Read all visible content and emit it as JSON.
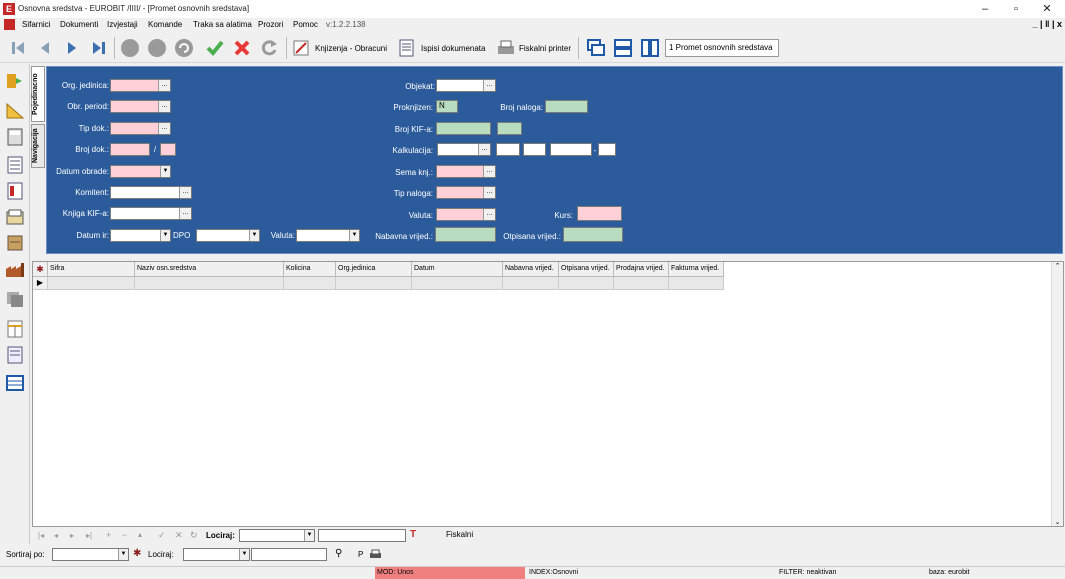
{
  "window": {
    "title": "Osnovna sredstva - EUROBIT /IIII/ - [Promet osnovnih sredstava]",
    "minimize": "–",
    "restore": "▫",
    "close": "✕",
    "mdi_controls": "_ | ǁ | x"
  },
  "menu": {
    "items": [
      "Sifarnici",
      "Dokumenti",
      "Izvjestaji",
      "Komande",
      "Traka sa alatima",
      "Prozori",
      "Pomoc",
      "v:1.2.2.138"
    ]
  },
  "toolbar": {
    "knjizenja_label": "Knjizenja - Obracuni",
    "ispisi_label": "Ispisi dokumenata",
    "fiskalni_label": "Fiskalni printer",
    "window_tab_label": "1 Promet osnovnih sredstava"
  },
  "tabs": {
    "pojedinacno": "Pojedinacno",
    "navigacija": "Navigacija"
  },
  "form": {
    "org_jedinica": "Org. jedinica:",
    "obr_period": "Obr. period:",
    "tip_dok": "Tip dok.:",
    "broj_dok": "Broj dok.:",
    "broj_dok_sep": "/",
    "datum_obrade": "Datum obrade:",
    "komitent": "Komitent:",
    "knjiga_kif": "Knjiga KIF-a:",
    "datum_ir": "Datum ir:",
    "dpo": "DPO",
    "valuta_left": "Valuta:",
    "objekat": "Objekat:",
    "proknjizen": "Proknjizen:",
    "proknjizen_value": "N",
    "broj_naloga": "Broj naloga:",
    "broj_kif": "Broj KIF-a:",
    "kalkulacija": "Kalkulacija:",
    "kalkulacija_sep": "-",
    "sema_knj": "Sema knj.:",
    "tip_naloga": "Tip naloga:",
    "valuta": "Valuta:",
    "kurs": "Kurs:",
    "nabavna_vrijed": "Nabavna vrijed.:",
    "otpisana_vrijed": "Otpisana vrijed.:",
    "ellipsis": "..."
  },
  "grid": {
    "columns": [
      "Sifra",
      "Naziv osn.sredstva",
      "Kolicina",
      "Org.jedinica",
      "Datum",
      "Nabavna vrijed.",
      "Otpisana vrijed.",
      "Prodajna vrijed.",
      "Fakturna vrijed."
    ],
    "row_marker": "▶"
  },
  "navbar": {
    "lociraj_label": "Lociraj:",
    "fiskalni": "Fiskalni"
  },
  "sortbar": {
    "sortiraj_label": "Sortiraj po:",
    "lociraj_label": "Lociraj:",
    "p_label": "P"
  },
  "status": {
    "mod": "MOD: Unos",
    "index": "INDEX:Osnovni",
    "filter": "FILTER: neaktivan",
    "baza": "baza: eurobit"
  },
  "colors": {
    "form_bg": "#2b5b9b",
    "required_field": "#ffd0d8",
    "readonly_field": "#b8dcc0",
    "status_mod_bg": "#f08080"
  }
}
